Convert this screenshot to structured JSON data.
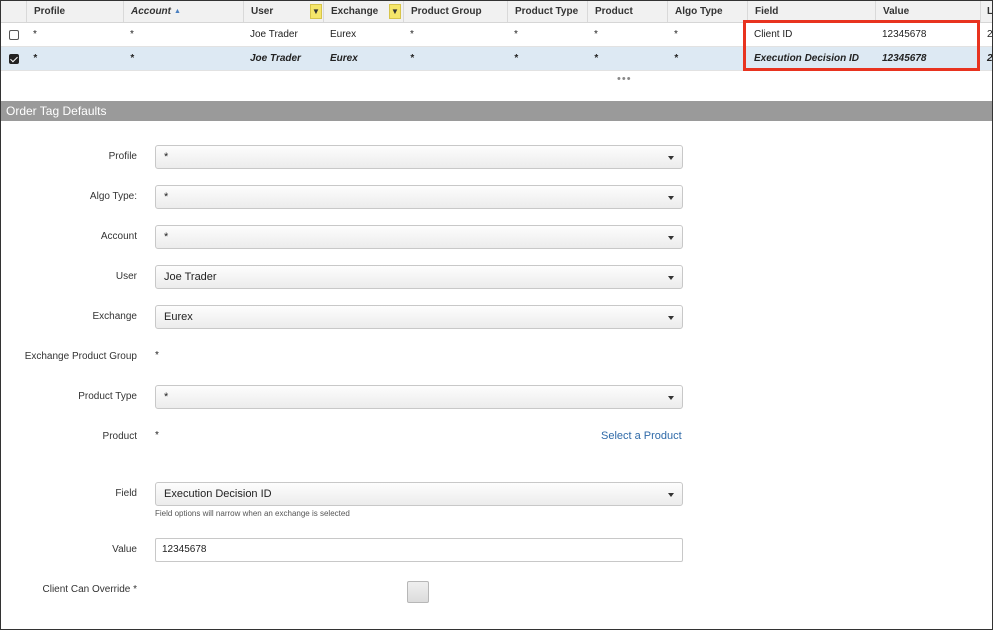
{
  "grid": {
    "columns": [
      {
        "label": "Profile"
      },
      {
        "label": "Account"
      },
      {
        "label": "User"
      },
      {
        "label": "Exchange"
      },
      {
        "label": "Product Group"
      },
      {
        "label": "Product Type"
      },
      {
        "label": "Product"
      },
      {
        "label": "Algo Type"
      },
      {
        "label": "Field"
      },
      {
        "label": "Value"
      },
      {
        "label": "L"
      }
    ],
    "rows": [
      {
        "profile": "*",
        "account": "*",
        "user": "Joe Trader",
        "exchange": "Eurex",
        "product_group": "*",
        "product_type": "*",
        "product": "*",
        "algo_type": "*",
        "field": "Client ID",
        "value": "12345678",
        "extra": "2"
      },
      {
        "profile": "*",
        "account": "*",
        "user": "Joe Trader",
        "exchange": "Eurex",
        "product_group": "*",
        "product_type": "*",
        "product": "*",
        "algo_type": "*",
        "field": "Execution Decision ID",
        "value": "12345678",
        "extra": "2"
      }
    ],
    "more_indicator": "•••"
  },
  "form": {
    "section_title": "Order Tag Defaults",
    "profile": {
      "label": "Profile",
      "value": "*"
    },
    "algo_type": {
      "label": "Algo Type:",
      "value": "*"
    },
    "account": {
      "label": "Account",
      "value": "*"
    },
    "user": {
      "label": "User",
      "value": "Joe Trader"
    },
    "exchange": {
      "label": "Exchange",
      "value": "Eurex"
    },
    "exchange_product_group": {
      "label": "Exchange Product Group",
      "value": "*"
    },
    "product_type": {
      "label": "Product Type",
      "value": "*"
    },
    "product": {
      "label": "Product",
      "value": "*",
      "link": "Select a Product"
    },
    "field": {
      "label": "Field",
      "value": "Execution Decision ID",
      "hint": "Field options will narrow when an exchange is selected"
    },
    "value": {
      "label": "Value",
      "value": "12345678"
    },
    "client_can_override": {
      "label": "Client Can Override *",
      "checked": false
    }
  }
}
